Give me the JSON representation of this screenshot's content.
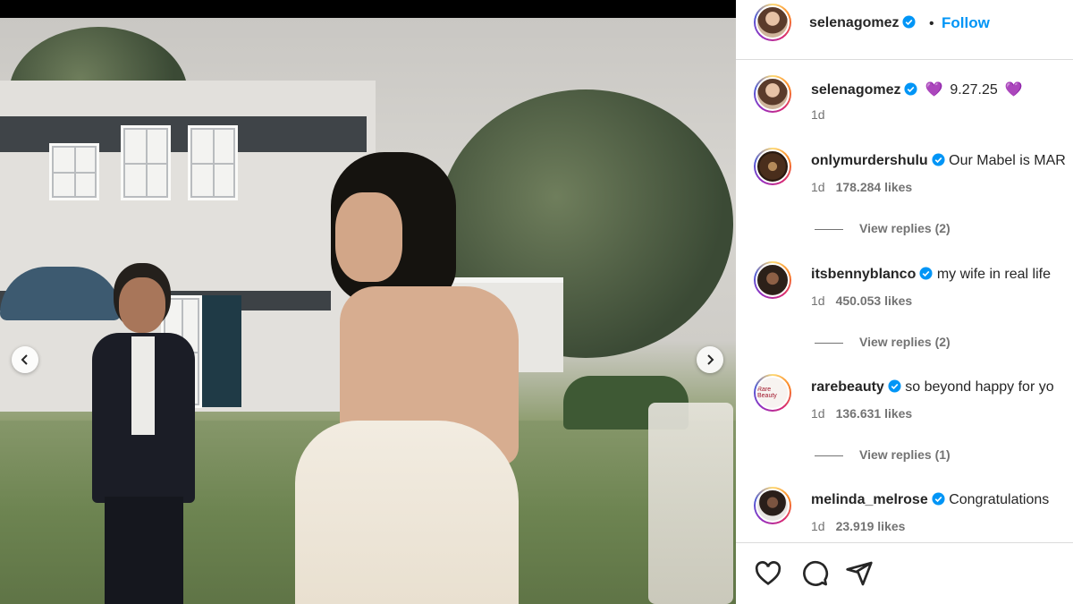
{
  "post": {
    "author": "selenagomez",
    "follow_label": "Follow",
    "dot": "•",
    "carousel": {
      "prev_icon": "chevron-left-icon",
      "next_icon": "chevron-right-icon"
    }
  },
  "caption": {
    "username": "selenagomez",
    "text": "9.27.25",
    "heart_emoji": "💜",
    "time": "1d"
  },
  "comments": [
    {
      "username": "onlymurdershulu",
      "text": "Our Mabel is MAR",
      "time": "1d",
      "likes": "178.284 likes",
      "replies": "View replies (2)"
    },
    {
      "username": "itsbennyblanco",
      "text": "my wife in real life",
      "time": "1d",
      "likes": "450.053 likes",
      "replies": "View replies (2)"
    },
    {
      "username": "rarebeauty",
      "text": "so beyond happy for yo",
      "time": "1d",
      "likes": "136.631 likes",
      "replies": "View replies (1)",
      "avatar_text": "Rare Beauty"
    },
    {
      "username": "melinda_melrose",
      "text": "Congratulations",
      "time": "1d",
      "likes": "23.919 likes"
    }
  ],
  "actions": {
    "like_icon": "heart-icon",
    "comment_icon": "comment-icon",
    "share_icon": "share-icon"
  },
  "colors": {
    "link": "#0095f6",
    "verified": "#0095f6",
    "text": "#262626",
    "muted": "#737373"
  }
}
